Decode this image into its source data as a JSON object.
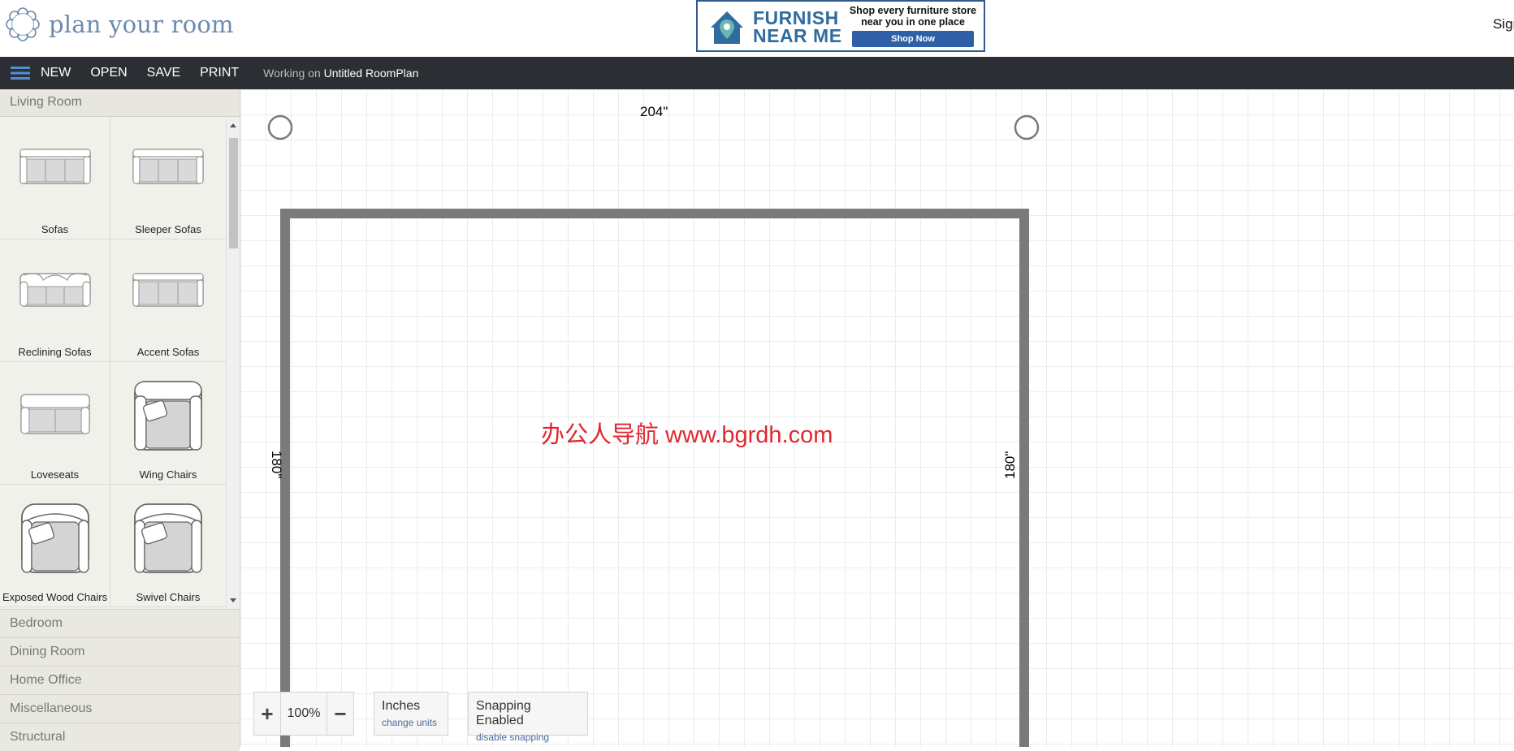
{
  "header": {
    "logo_text": "plan your room",
    "signin": "Sign"
  },
  "ad": {
    "brand_line1": "FURNISH",
    "brand_line2": "NEAR ME",
    "tagline_line1": "Shop every furniture store",
    "tagline_line2": "near you in one place",
    "button": "Shop Now"
  },
  "toolbar": {
    "new": "NEW",
    "open": "OPEN",
    "save": "SAVE",
    "print": "PRINT",
    "working_prefix": "Working on",
    "file_name": "Untitled RoomPlan"
  },
  "sidebar": {
    "active_category": "Living Room",
    "items": [
      {
        "label": "Sofas",
        "icon": "sofa-icon"
      },
      {
        "label": "Sleeper Sofas",
        "icon": "sleeper-sofa-icon"
      },
      {
        "label": "Reclining Sofas",
        "icon": "reclining-sofa-icon"
      },
      {
        "label": "Accent Sofas",
        "icon": "accent-sofa-icon"
      },
      {
        "label": "Loveseats",
        "icon": "loveseat-icon"
      },
      {
        "label": "Wing Chairs",
        "icon": "wing-chair-icon"
      },
      {
        "label": "Exposed Wood Chairs",
        "icon": "exposed-wood-chair-icon"
      },
      {
        "label": "Swivel Chairs",
        "icon": "swivel-chair-icon"
      }
    ],
    "categories": [
      "Bedroom",
      "Dining Room",
      "Home Office",
      "Miscellaneous",
      "Structural"
    ]
  },
  "canvas": {
    "wall_top": "204\"",
    "wall_left": "180\"",
    "wall_right": "180\"",
    "watermark": "办公人导航 www.bgrdh.com"
  },
  "zoom": {
    "plus": "+",
    "value": "100%",
    "minus": "−"
  },
  "units": {
    "main": "Inches",
    "link": "change units"
  },
  "snapping": {
    "main": "Snapping Enabled",
    "link": "disable snapping"
  },
  "colors": {
    "toolbar_bg": "#2b2e33",
    "wall": "#7a7a7a",
    "accent_blue": "#4a6c9a",
    "watermark": "#e0282f"
  }
}
